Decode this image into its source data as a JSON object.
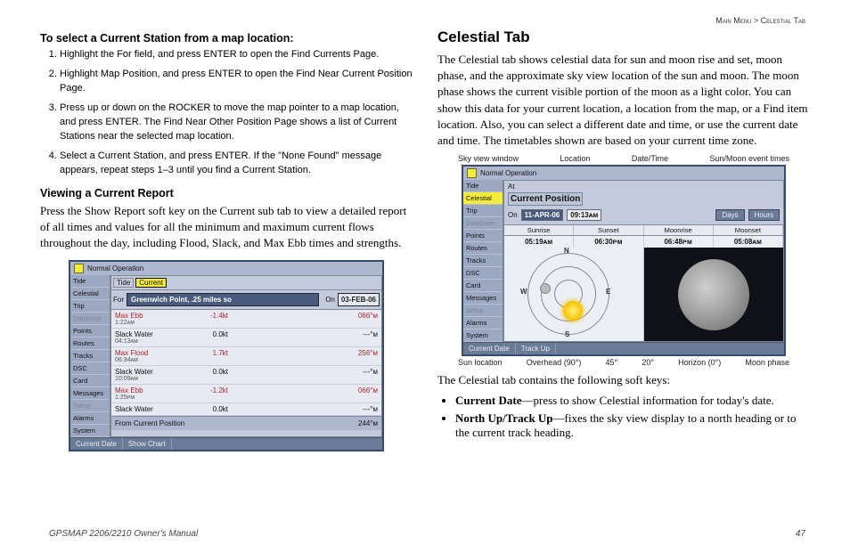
{
  "header_right": "Main Menu > Celestial Tab",
  "footer_left": "GPSMAP 2206/2210 Owner's Manual",
  "footer_right": "47",
  "left": {
    "h1": "To select a Current Station from a map location:",
    "steps": [
      "Highlight the For field, and press ENTER to open the Find Currents Page.",
      "Highlight Map Position, and press ENTER to open the Find Near Current Position Page.",
      "Press up or down on the ROCKER to move the map pointer to a map location, and press ENTER. The Find Near Other Position Page shows a list of Current Stations near the selected map location.",
      "Select a Current Station, and press ENTER. If the \"None Found\" message appears, repeat steps 1–3 until you find a Current Station."
    ],
    "h2": "Viewing a Current Report",
    "p": "Press the Show Report soft key on the Current sub tab to view a detailed report of all times and values for all the minimum and maximum current flows throughout the day, including Flood, Slack, and Max Ebb times and strengths.",
    "device": {
      "title": "Normal Operation",
      "tabs": [
        "Tide",
        "Celestial",
        "Trip",
        "Database",
        "Points",
        "Routes",
        "Tracks",
        "DSC",
        "Card",
        "Messages",
        "Setup",
        "Alarms",
        "System"
      ],
      "subtabs": {
        "a": "Tide",
        "b": "Current"
      },
      "for_label": "For",
      "for_value": "Greenwich Point, .25 miles so",
      "on_label": "On",
      "on_value": "03-FEB-06",
      "rows": [
        {
          "name": "Max Ebb",
          "time": "1:22ᴀᴍ",
          "v": "-1.4kt",
          "p": "066°ᴍ"
        },
        {
          "name": "Slack Water",
          "time": "04:13ᴀᴍ",
          "v": "0.0kt",
          "p": "---°ᴍ"
        },
        {
          "name": "Max Flood",
          "time": "06:34ᴀᴍ",
          "v": "1.7kt",
          "p": "256°ᴍ"
        },
        {
          "name": "Slack Water",
          "time": "10:09ᴀᴍ",
          "v": "0.0kt",
          "p": "---°ᴍ"
        },
        {
          "name": "Max Ebb",
          "time": "1:25ᴘᴍ",
          "v": "-1.2kt",
          "p": "066°ᴍ"
        },
        {
          "name": "Slack Water",
          "time": "",
          "v": "0.0kt",
          "p": "---°ᴍ"
        }
      ],
      "from": "From Current Position",
      "from_dist": "244°ᴍ",
      "bot": [
        "Current Date",
        "Show Chart"
      ]
    }
  },
  "right": {
    "h": "Celestial Tab",
    "p1": "The Celestial tab shows celestial data for sun and moon rise and set, moon phase, and the approximate sky view location of the sun and moon. The moon phase shows the current visible portion of the moon as a light color. You can show this data for your current location, a location from the map, or a Find item location. Also, you can select a different date and time, or use the current date and time. The timetables shown are based on your current time zone.",
    "annot_top": [
      "Sky view window",
      "Location",
      "Date/Time",
      "Sun/Moon event times"
    ],
    "annot_bot": [
      "Sun location",
      "Overhead (90°)",
      "45°",
      "20°",
      "Horizon (0°)",
      "Moon phase"
    ],
    "device": {
      "title": "Normal Operation",
      "tabs": [
        "Tide",
        "Celestial",
        "Trip",
        "Database",
        "Points",
        "Routes",
        "Tracks",
        "DSC",
        "Card",
        "Messages",
        "Setup",
        "Alarms",
        "System"
      ],
      "at": "At",
      "cp": "Current Position",
      "on": "On",
      "date": "11-APR-06",
      "time": "09:13ᴀᴍ",
      "btn_days": "Days",
      "btn_hours": "Hours",
      "cols": [
        "Sunrise",
        "Sunset",
        "Moonrise",
        "Moonset"
      ],
      "vals": [
        "05:19ᴀᴍ",
        "06:30ᴘᴍ",
        "06:48ᴘᴍ",
        "05:08ᴀᴍ"
      ],
      "nsew": {
        "n": "N",
        "s": "S",
        "e": "E",
        "w": "W"
      },
      "bot": [
        "Current Date",
        "Track Up"
      ]
    },
    "p2": "The Celestial tab contains the following soft keys:",
    "softkeys": [
      {
        "t": "Current Date",
        "d": "—press to show Celestial information for today's date."
      },
      {
        "t": "North Up/Track Up",
        "d": "—fixes the sky view display to a north heading or to the current track heading."
      }
    ]
  }
}
